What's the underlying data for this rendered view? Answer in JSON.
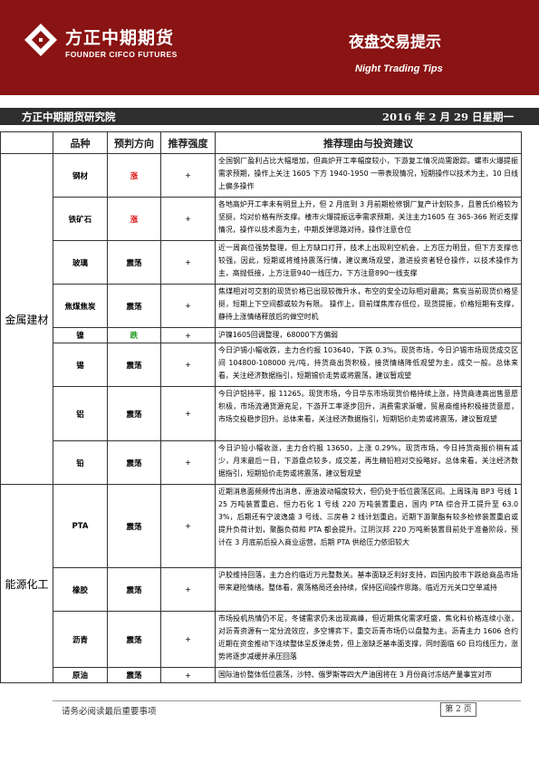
{
  "header": {
    "company_cn": "方正中期期货",
    "company_en": "FOUNDER CIFCO FUTURES",
    "title_cn": "夜盘交易提示",
    "title_en": "Night Trading Tips",
    "brand_color": "#8a1313"
  },
  "subbar": {
    "institute": "方正中期期货研究院",
    "date": "2016 年 2 月 29 日星期一"
  },
  "table": {
    "headers": [
      "品种",
      "预判方向",
      "推荐强度",
      "推荐理由与投资建议"
    ],
    "groups": [
      {
        "category": "金属建材",
        "rows": [
          {
            "name": "钢材",
            "direction": "涨",
            "dir_color": "red",
            "strength": "+",
            "reason": "全国钢厂盈利占比大幅增加，但高炉开工率幅度较小，下游复工情况尚需跟踪。螺市火爆提振需求预期，操作上关注 1605 下方 1940-1950 一带表现情况，短期操作以技术为主，10 日线上偏多操作"
          },
          {
            "name": "铁矿石",
            "direction": "涨",
            "dir_color": "red",
            "strength": "+",
            "reason": "各地高炉开工率未有明显上升，但 2 月底到 3 月前期检修钢厂复产计划较多，且普氏价格较为坚挺，均对价格有所支撑。楼市火爆提振远季需求预期，关注主力1605 在 365-366 附近支撑情况，操作以技术面为主，中期反弹思路对待，操作注意仓位"
          },
          {
            "name": "玻璃",
            "direction": "震荡",
            "dir_color": "black",
            "strength": "+",
            "reason": "近一周高位强势整理，但上方缺口打开，技术上出现利空机会，上方压力明显，但下方支撑也较强。因此，短期或将维持震荡行情，建议离场观望，激进投资者轻仓操作，以技术操作为主，高抛低接，上方注意940一线压力，下方注意890一线支撑"
          },
          {
            "name": "焦煤焦炭",
            "direction": "震荡",
            "dir_color": "black",
            "strength": "+",
            "reason": "焦煤相对可交割的现货价格已出现较微升水，布空的安全边际相对最高；焦炭当前现货价格坚 挺，短期上下空间都或较为有限。 操作上，目前煤焦库存低位，现货提振，价格短期有支撑，静待上涨情绪释放后的做空时机"
          },
          {
            "name": "镍",
            "direction": "跌",
            "dir_color": "green",
            "strength": "+",
            "reason": "沪镍1605回调整理，68000下方偏弱"
          },
          {
            "name": "锡",
            "direction": "震荡",
            "dir_color": "black",
            "strength": "+",
            "reason": "今日沪锡小幅收跌，主力合约报 103640，下跌 0.3%。现货市场，今日沪锡市场现货成交区间 104800-108000 元/吨，持货商出货积极，接货情绪降低观望为主，成交一般。总体来看，关注经济数据指引，短期锡价走势或将震荡，建议暂观望"
          },
          {
            "name": "铝",
            "direction": "震荡",
            "dir_color": "black",
            "strength": "+",
            "reason": "今日沪铝持平，报 11265。现货市场，今日华东市场现货价格持续上涨，持货商逢高出售意愿积极，市场流通货源充足，下游开工率逐步回升，消费需求渐暖，贸易商维持积极接货意愿，市场交投稳步回升。总体来看，关注经济数据指引，短期铝价走势或将震荡，建议暂观望"
          },
          {
            "name": "铅",
            "direction": "震荡",
            "dir_color": "black",
            "strength": "+",
            "reason": "今日沪铅小幅收涨，主力合约报 13650，上涨 0.29%。现货市场，今日持货商报价稍有减少，月末最后一日，下游盘点较多，成交差，再生精铅相对交投略好。总体来看，关注经济数据指引，短期铅价走势或将震荡，建议暂观望"
          }
        ]
      },
      {
        "category": "能源化工",
        "rows": [
          {
            "name": "PTA",
            "direction": "震荡",
            "dir_color": "black",
            "strength": "+",
            "reason": "近期消息面频频传出消息，原油波动幅度较大，但仍处于低位震荡区间。上周珠海 BP3 号线 125 万吨装置重启、恒力石化 1 号线 220 万吨装置重启，国内 PTA 综合开工提升至 63.03%，后期还有宁波逸盛 3 号线、三房巷 2 线计划重启。近期下游聚酯有较多检修装置重启或提升负荷计划，聚酯负荷和 PTA 都会提升。江阴汉邦 220 万吨新装置目前处于准备阶段，预计在 3 月底前后投入商业运营，后期 PTA 供给压力依旧较大"
          },
          {
            "name": "橡胶",
            "direction": "震荡",
            "dir_color": "black",
            "strength": "+",
            "reason": "沪胶维持回落，主力合约临近万元整数关。基本面缺乏利好支持，四国内胶市下跌给商品市场带来避险情绪。整体看，震荡格局还会持续，保持区间操作思路。临近万元关口空单减持"
          },
          {
            "name": "沥青",
            "direction": "震荡",
            "dir_color": "black",
            "strength": "+",
            "reason": "市场投机热情仍不足，冬储需求仍未出现高峰，但近期焦化需求旺盛，焦化料价格连续小涨，对沥青资源有一定分流效应，多空博弈下，重交沥青市场仍以盘整为主。沥青主力 1606 合约近期在资金推动下连续整体呈反弹走势，但上涨缺乏基本面支撑，同时面临 60 日均线压力，涨势将逐步减缓并承压回落"
          },
          {
            "name": "原油",
            "direction": "震荡",
            "dir_color": "black",
            "strength": "+",
            "reason": "国际油价整体低位震荡，沙特、俄罗斯等四大产油国将在 3 月份商讨冻结产量事宜对市"
          }
        ]
      }
    ]
  },
  "footer": {
    "note": "请务必阅读最后重要事项",
    "page": "第 2 页"
  }
}
